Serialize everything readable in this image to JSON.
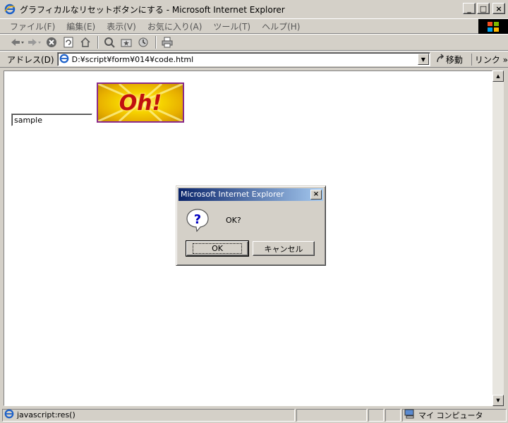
{
  "window": {
    "title": "グラフィカルなリセットボタンにする - Microsoft Internet Explorer",
    "minimize_glyph": "_",
    "maximize_glyph": "□",
    "close_glyph": "×"
  },
  "menu": {
    "items": [
      {
        "label": "ファイル(F)"
      },
      {
        "label": "編集(E)"
      },
      {
        "label": "表示(V)"
      },
      {
        "label": "お気に入り(A)"
      },
      {
        "label": "ツール(T)"
      },
      {
        "label": "ヘルプ(H)"
      }
    ]
  },
  "toolbar": {
    "icons": [
      "back-icon",
      "forward-icon",
      "stop-icon",
      "refresh-icon",
      "home-icon",
      "search-icon",
      "favorites-icon",
      "history-icon",
      "print-icon"
    ]
  },
  "address": {
    "label": "アドレス(D)",
    "value": "D:¥script¥form¥014¥code.html",
    "go_label": "移動",
    "links_label": "リンク »"
  },
  "page": {
    "input_value": "sample",
    "image_button_text": "Oh!"
  },
  "dialog": {
    "title": "Microsoft Internet Explorer",
    "message": "OK?",
    "ok_label": "OK",
    "cancel_label": "キャンセル",
    "close_glyph": "×",
    "icon": "question-icon"
  },
  "status": {
    "text": "javascript:res()",
    "zone": "マイ コンピュータ"
  },
  "colors": {
    "titlebar_active": "#0a246a",
    "titlebar_gradient_end": "#a6caf0",
    "chrome": "#d4d0c8",
    "oh_button_border": "#8a2a8a"
  }
}
